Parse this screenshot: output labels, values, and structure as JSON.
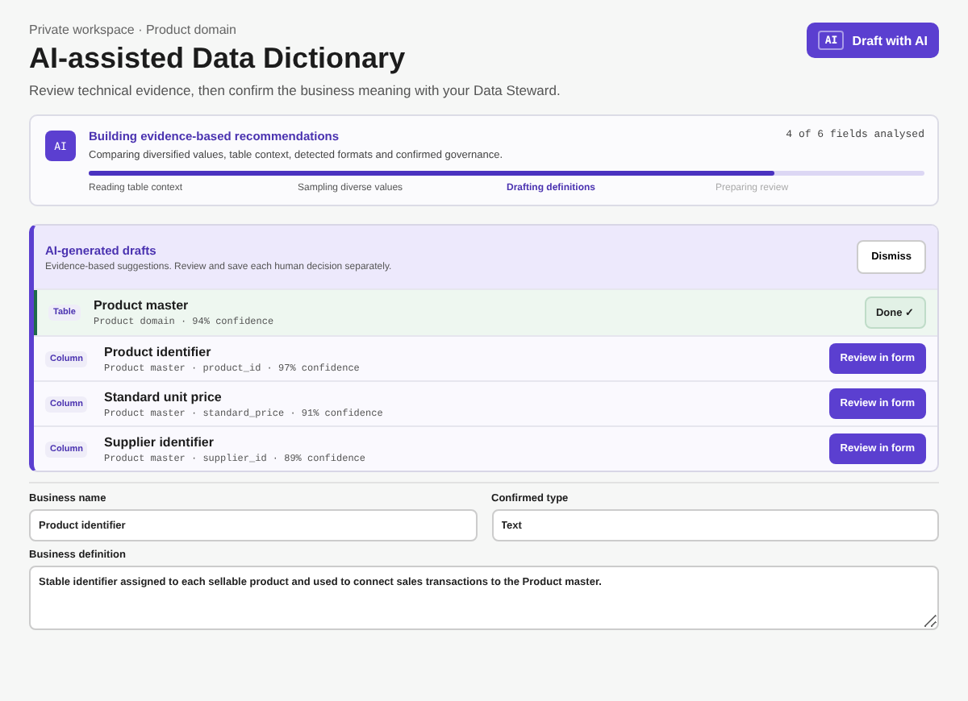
{
  "header": {
    "breadcrumb": "Private workspace · Product domain",
    "title": "AI-assisted Data Dictionary",
    "subtitle": "Review technical evidence, then confirm the business meaning with your Data Steward.",
    "button": {
      "badge": "AI",
      "label": "Draft with AI"
    }
  },
  "progress": {
    "badge": "AI",
    "title": "Building evidence-based recommendations",
    "description": "Comparing diversified values, table context, detected formats and confirmed governance.",
    "count": "4 of 6 fields analysed",
    "level": 0.82,
    "steps": [
      {
        "label": "Reading table context",
        "done": true,
        "current": false
      },
      {
        "label": "Sampling diverse values",
        "done": true,
        "current": false
      },
      {
        "label": "Drafting definitions",
        "done": false,
        "current": true
      },
      {
        "label": "Preparing review",
        "done": false,
        "current": false
      }
    ]
  },
  "drafts": {
    "title": "AI-generated drafts",
    "description": "Evidence-based suggestions. Review and save each human decision separately.",
    "dismiss": "Dismiss",
    "items": [
      {
        "kind": "table",
        "tag": "Table",
        "name": "Product master",
        "meta": "Product domain · 94% confidence",
        "done": true,
        "action": "Done ✓"
      },
      {
        "kind": "column",
        "tag": "Column",
        "name": "Product identifier",
        "meta": "Product master · product_id · 97% confidence",
        "done": false,
        "action": "Review in form"
      },
      {
        "kind": "column",
        "tag": "Column",
        "name": "Standard unit price",
        "meta": "Product master · standard_price · 91% confidence",
        "done": false,
        "action": "Review in form"
      },
      {
        "kind": "column",
        "tag": "Column",
        "name": "Supplier identifier",
        "meta": "Product master · supplier_id · 89% confidence",
        "done": false,
        "action": "Review in form"
      }
    ]
  },
  "form": {
    "business_name": {
      "label": "Business name",
      "value": "Product identifier"
    },
    "confirmed_type": {
      "label": "Confirmed type",
      "value": "Text"
    },
    "business_definition": {
      "label": "Business definition",
      "value": "Stable identifier assigned to each sellable product and used to connect sales transactions to the Product master."
    }
  }
}
